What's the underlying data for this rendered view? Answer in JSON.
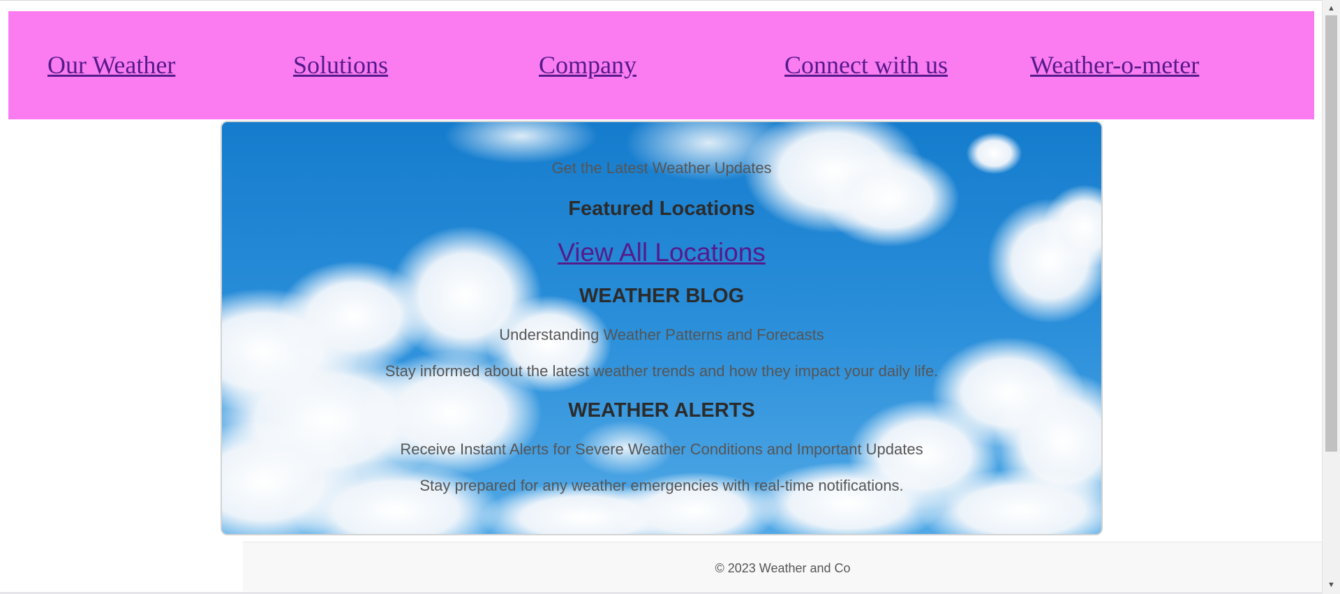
{
  "nav": {
    "items": [
      {
        "label": "Our Weather"
      },
      {
        "label": "Solutions"
      },
      {
        "label": "Company"
      },
      {
        "label": "Connect with us"
      },
      {
        "label": "Weather-o-meter"
      }
    ],
    "background_color": "#fb7cf0",
    "link_color": "#551a8b"
  },
  "hero": {
    "tagline": "Get the Latest Weather Updates",
    "featured_heading": "Featured Locations",
    "view_all_link": "View All Locations",
    "blog_heading": "WEATHER BLOG",
    "blog_title": "Understanding Weather Patterns and Forecasts",
    "blog_text": "Stay informed about the latest weather trends and how they impact your daily life.",
    "alerts_heading": "WEATHER ALERTS",
    "alerts_title": "Receive Instant Alerts for Severe Weather Conditions and Important Updates",
    "alerts_text": "Stay prepared for any weather emergencies with real-time notifications."
  },
  "footer": {
    "copyright": "© 2023 Weather and Co"
  },
  "scrollbar": {
    "up_icon": "scroll-up-arrow-icon",
    "down_icon": "scroll-down-arrow-icon"
  }
}
